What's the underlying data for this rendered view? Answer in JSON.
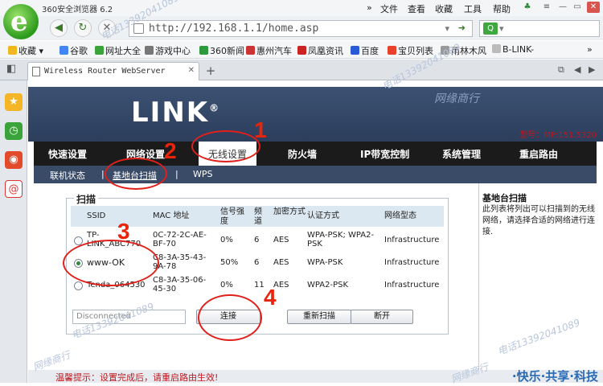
{
  "browser": {
    "title": "360安全浏览器 6.2",
    "menu": [
      "文件",
      "查看",
      "收藏",
      "工具",
      "帮助"
    ],
    "url": "http://192.168.1.1/home.asp",
    "bookmarks": [
      "收藏",
      "谷歌",
      "网址大全",
      "游戏中心",
      "360新闻",
      "惠州汽车",
      "凤凰资讯",
      "百度",
      "宝贝列表",
      "雨林木风",
      "B-LINK-"
    ],
    "tab_title": "Wireless Router WebServer"
  },
  "router": {
    "brand": "LINK",
    "model": "型号：MP:151.5320",
    "main_nav": [
      "快速设置",
      "网络设置",
      "无线设置",
      "防火墙",
      "IP带宽控制",
      "系统管理",
      "重启路由"
    ],
    "sub_nav": [
      "联机状态",
      "基地台扫描",
      "WPS"
    ],
    "scan": {
      "legend": "扫描",
      "headers": [
        "SSID",
        "MAC 地址",
        "信号强度",
        "频道",
        "加密方式",
        "认证方式",
        "网络型态"
      ],
      "rows": [
        {
          "ssid": "TP-LINK_ABC770",
          "mac": "0C-72-2C-AE-BF-70",
          "signal": "0%",
          "channel": "6",
          "enc": "AES",
          "auth": "WPA-PSK; WPA2-PSK",
          "type": "Infrastructure",
          "selected": false
        },
        {
          "ssid": "www-OK",
          "mac": "C8-3A-35-43-9A-78",
          "signal": "50%",
          "channel": "6",
          "enc": "AES",
          "auth": "WPA-PSK",
          "type": "Infrastructure",
          "selected": true
        },
        {
          "ssid": "Tenda_064530",
          "mac": "C8-3A-35-06-45-30",
          "signal": "0%",
          "channel": "11",
          "enc": "AES",
          "auth": "WPA2-PSK",
          "type": "Infrastructure",
          "selected": false
        }
      ],
      "status_value": "Disconnected",
      "buttons": [
        "连接",
        "重新扫描",
        "断开"
      ]
    },
    "help": {
      "title": "基地台扫描",
      "text": "此列表将列出可以扫描到的无线网络，请选择合适的网络进行连接."
    },
    "footer_tip": "温馨提示：设置完成后，请重启路由生效!",
    "slogan": "·快乐·共享·科技"
  },
  "annotations": [
    "1",
    "2",
    "3",
    "4"
  ],
  "watermarks": [
    "网缘商行",
    "电话13392041089"
  ]
}
